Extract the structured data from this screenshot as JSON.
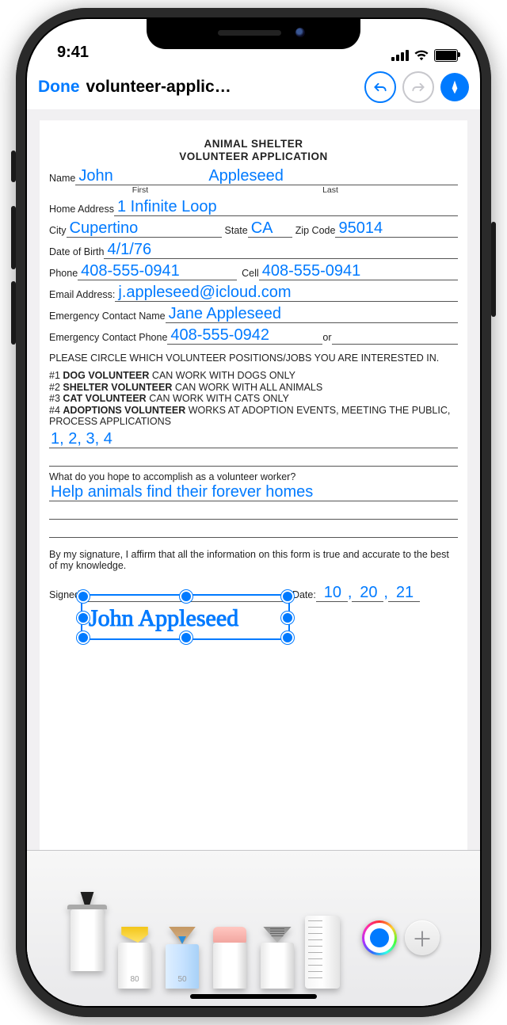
{
  "status": {
    "time": "9:41"
  },
  "nav": {
    "done_label": "Done",
    "title_truncated": "volunteer-applic…",
    "undo_enabled": true,
    "redo_enabled": false
  },
  "document": {
    "header_line1": "ANIMAL SHELTER",
    "header_line2": "VOLUNTEER APPLICATION",
    "labels": {
      "name": "Name",
      "first": "First",
      "last": "Last",
      "home_address": "Home Address",
      "city": "City",
      "state": "State",
      "zip": "Zip Code",
      "dob": "Date of Birth",
      "phone": "Phone",
      "cell": "Cell",
      "email": "Email Address:",
      "emerg_name": "Emergency Contact Name",
      "emerg_phone": "Emergency Contact Phone",
      "or": "or",
      "positions_prompt": "PLEASE CIRCLE WHICH VOLUNTEER POSITIONS/JOBS YOU ARE INTERESTED IN.",
      "goal_prompt": "What do you hope to accomplish as a volunteer worker?",
      "affirmation": "By my signature, I affirm that all the information on this form is true and accurate to the best of my knowledge.",
      "signed": "Signed",
      "date": "Date:"
    },
    "options": {
      "opt1_num": "#1 ",
      "opt1_bold": "DOG VOLUNTEER",
      "opt1_rest": " CAN WORK WITH DOGS ONLY",
      "opt2_num": "#2 ",
      "opt2_bold": "SHELTER VOLUNTEER",
      "opt2_rest": " CAN WORK WITH ALL ANIMALS",
      "opt3_num": "#3 ",
      "opt3_bold": "CAT VOLUNTEER",
      "opt3_rest": " CAN WORK WITH CATS ONLY",
      "opt4_num": "#4 ",
      "opt4_bold": "ADOPTIONS VOLUNTEER",
      "opt4_rest": " WORKS AT ADOPTION EVENTS, MEETING THE PUBLIC, PROCESS APPLICATIONS"
    },
    "values": {
      "first_name": "John",
      "last_name": "Appleseed",
      "home_address": "1 Infinite Loop",
      "city": "Cupertino",
      "state": "CA",
      "zip": "95014",
      "dob": "4/1/76",
      "phone": "408-555-0941",
      "cell": "408-555-0941",
      "email": "j.appleseed@icloud.com",
      "emerg_name": "Jane Appleseed",
      "emerg_phone": "408-555-0942",
      "emerg_phone_alt": "",
      "positions_choice": "1, 2, 3, 4",
      "goal": "Help animals find their forever homes",
      "signature_text": "John Appleseed",
      "sign_date_m": "10",
      "sign_date_d": "20",
      "sign_date_y": "21"
    }
  },
  "palette": {
    "tools": {
      "pen": "pen",
      "marker": "marker",
      "pencil": "pencil",
      "eraser": "eraser",
      "lasso": "lasso",
      "ruler": "ruler"
    },
    "selected_tool": "pen",
    "marker_label": "80",
    "pencil_label": "50",
    "current_color": "#007aff"
  }
}
